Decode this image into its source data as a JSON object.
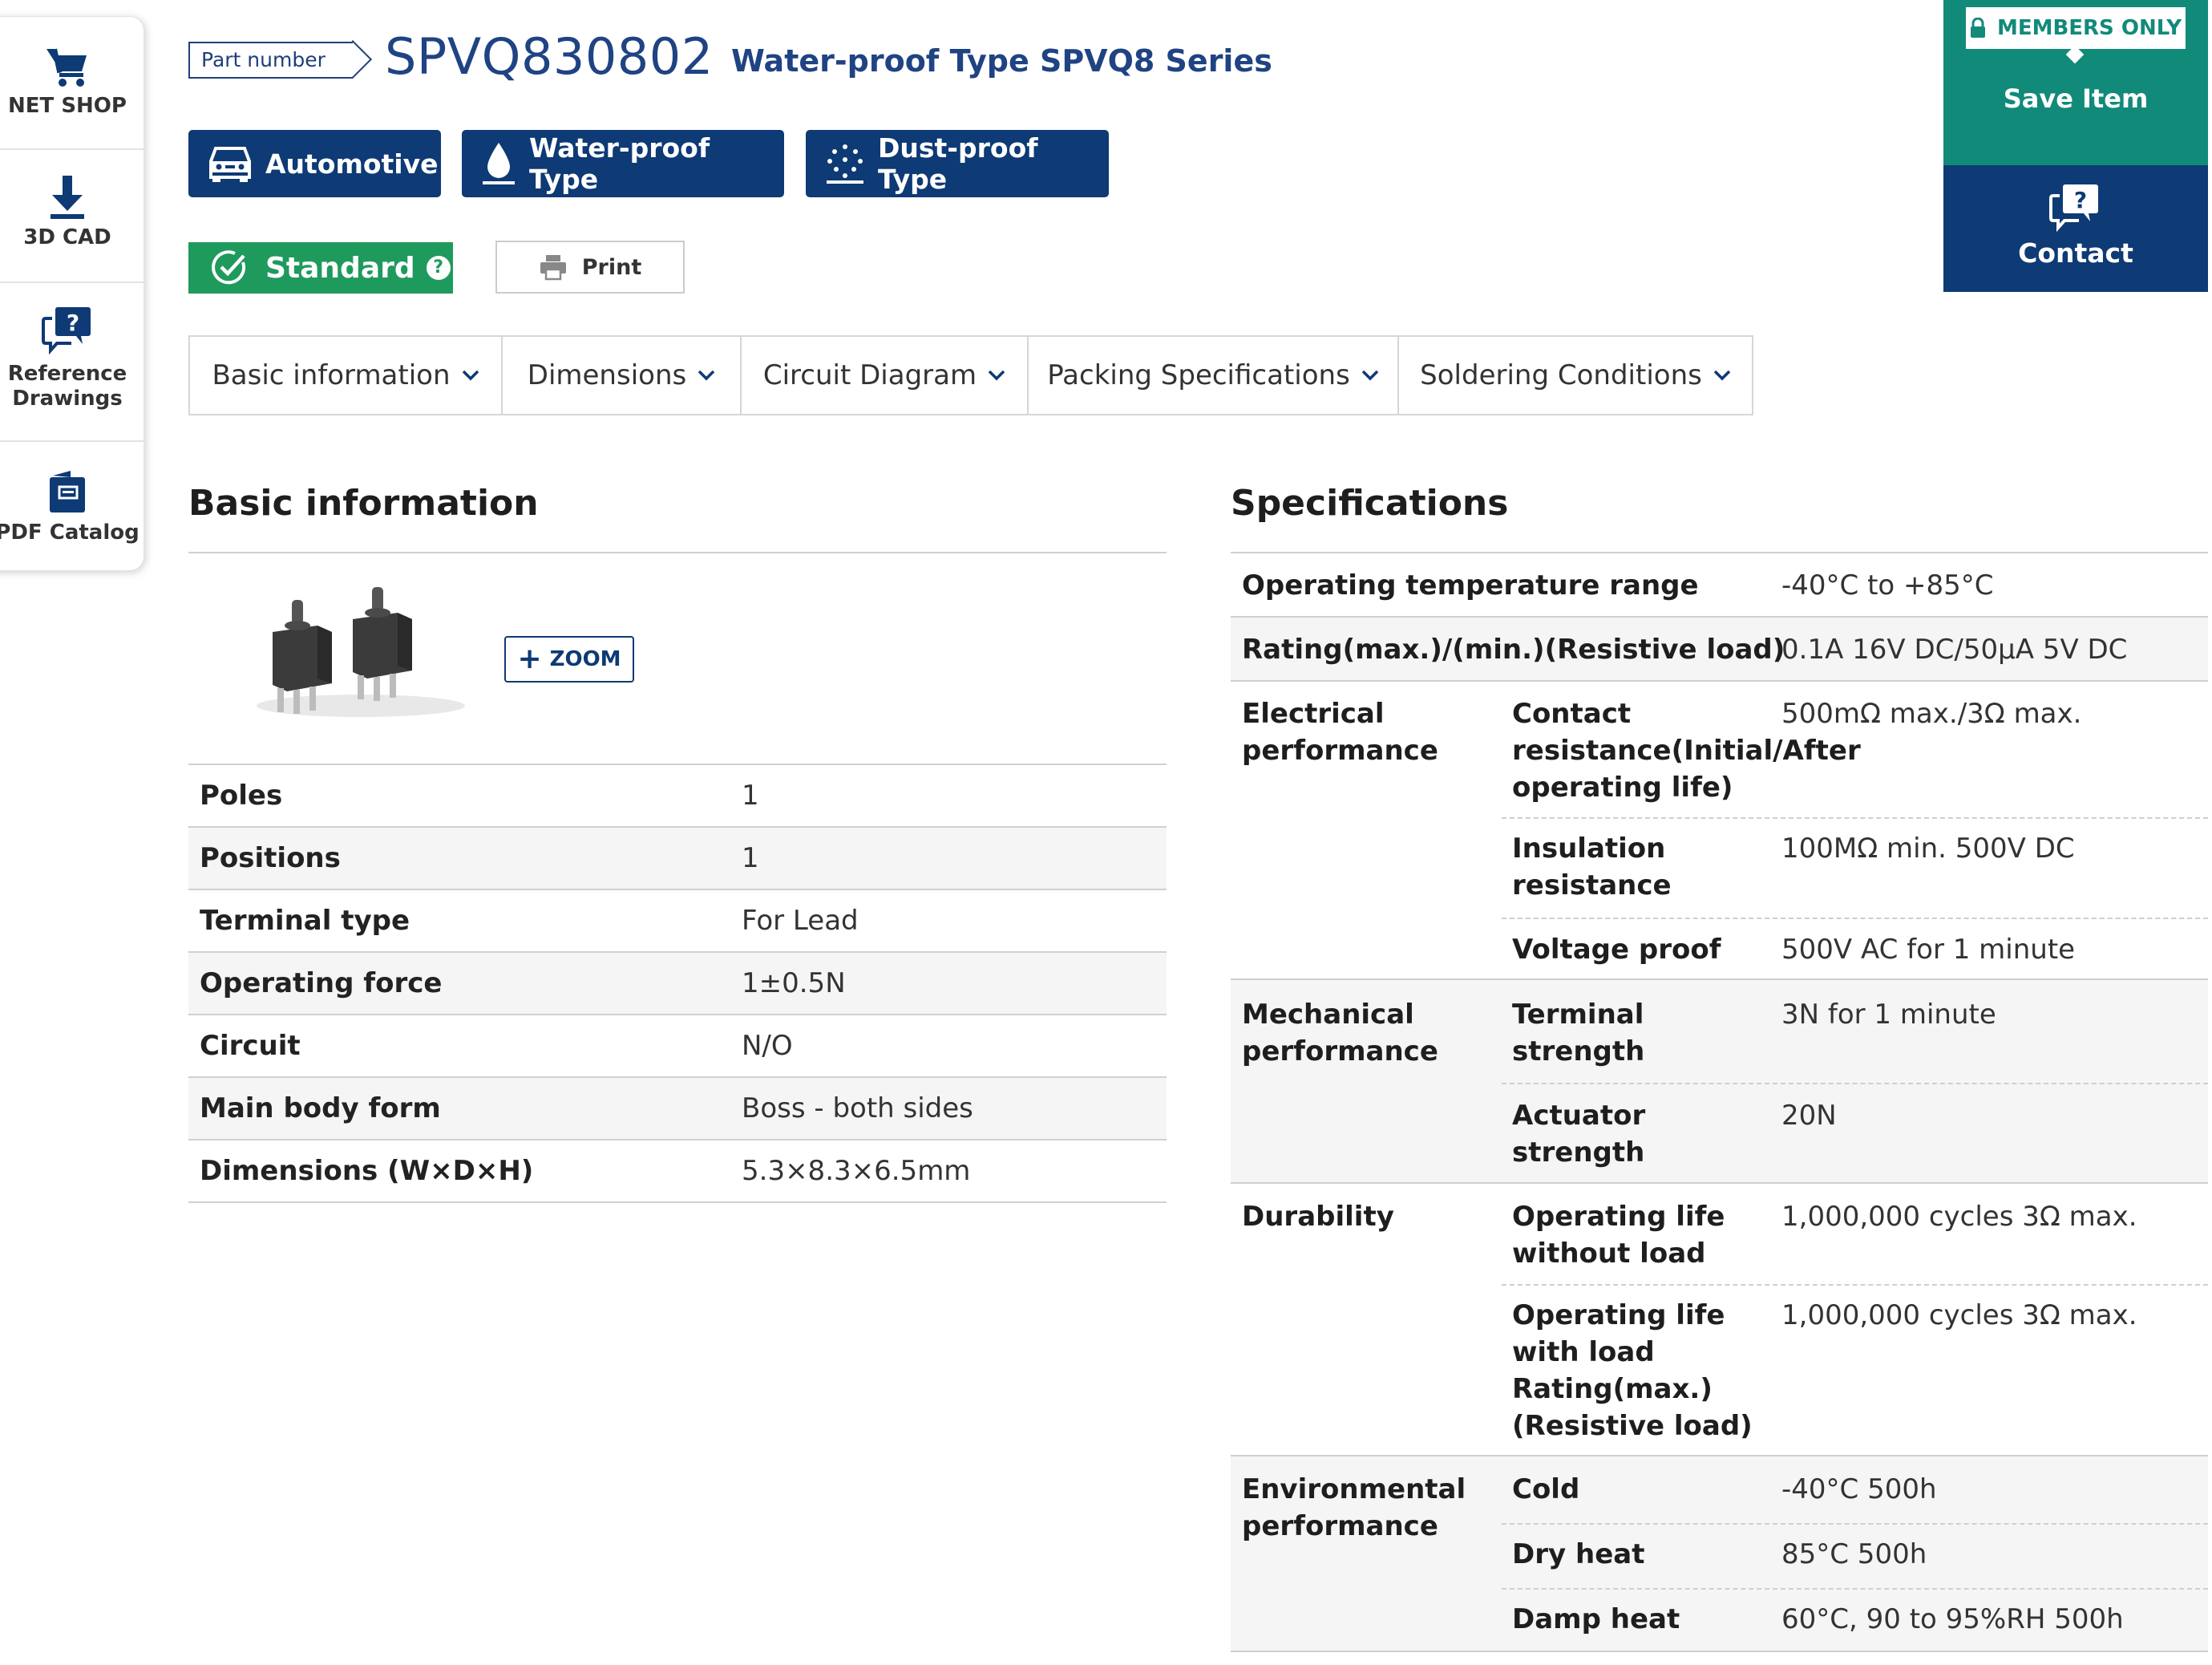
{
  "sidenav": {
    "items": [
      {
        "label": "NET SHOP",
        "icon": "cart-icon"
      },
      {
        "label": "3D CAD",
        "icon": "download-icon"
      },
      {
        "label": "Reference Drawings",
        "icon": "question-chat-icon"
      },
      {
        "label": "PDF Catalog",
        "icon": "catalog-icon"
      }
    ]
  },
  "header": {
    "part_tag": "Part number",
    "part_number": "SPVQ830802",
    "series": "Water-proof Type SPVQ8 Series",
    "features": [
      {
        "label": "Automotive",
        "icon": "car-icon"
      },
      {
        "label": "Water-proof Type",
        "icon": "water-drop-icon"
      },
      {
        "label": "Dust-proof Type",
        "icon": "dust-icon"
      }
    ],
    "standard_label": "Standard",
    "print_label": "Print"
  },
  "members": {
    "tag": "MEMBERS ONLY",
    "save_label": "Save Item",
    "contact_label": "Contact"
  },
  "tabs": [
    "Basic information",
    "Dimensions",
    "Circuit Diagram",
    "Packing Specifications",
    "Soldering Conditions"
  ],
  "basic": {
    "title": "Basic information",
    "zoom_label": "ZOOM",
    "rows": [
      {
        "k": "Poles",
        "v": "1"
      },
      {
        "k": "Positions",
        "v": "1"
      },
      {
        "k": "Terminal type",
        "v": "For Lead"
      },
      {
        "k": "Operating force",
        "v": "1±0.5N"
      },
      {
        "k": "Circuit",
        "v": "N/O"
      },
      {
        "k": "Main body form",
        "v": "Boss - both sides"
      },
      {
        "k": "Dimensions (W×D×H)",
        "v": "5.3×8.3×6.5mm"
      }
    ]
  },
  "specs": {
    "title": "Specifications",
    "operating_temp": {
      "k": "Operating temperature range",
      "v": "-40°C to +85°C"
    },
    "rating": {
      "k": "Rating(max.)/(min.)(Resistive load)",
      "v": "0.1A 16V DC/50μA 5V DC"
    },
    "electrical": {
      "group": "Electrical performance",
      "items": [
        {
          "k": "Contact resistance(Initial/After operating life)",
          "v": "500mΩ max./3Ω max."
        },
        {
          "k": "Insulation resistance",
          "v": "100MΩ min. 500V DC"
        },
        {
          "k": "Voltage proof",
          "v": "500V AC for 1 minute"
        }
      ]
    },
    "mechanical": {
      "group": "Mechanical performance",
      "items": [
        {
          "k": "Terminal strength",
          "v": "3N for 1 minute"
        },
        {
          "k": "Actuator strength",
          "v": "20N"
        }
      ]
    },
    "durability": {
      "group": "Durability",
      "items": [
        {
          "k": "Operating life without load",
          "v": "1,000,000 cycles 3Ω max."
        },
        {
          "k": "Operating life with load Rating(max.)(Resistive load)",
          "v": "1,000,000 cycles 3Ω max."
        }
      ]
    },
    "environmental": {
      "group": "Environmental performance",
      "items": [
        {
          "k": "Cold",
          "v": "-40°C 500h"
        },
        {
          "k": "Dry heat",
          "v": "85°C 500h"
        },
        {
          "k": "Damp heat",
          "v": "60°C, 90 to 95%RH 500h"
        }
      ]
    }
  },
  "colors": {
    "navy": "#0e3a75",
    "teal": "#128a7a",
    "green": "#1f9a5d"
  }
}
